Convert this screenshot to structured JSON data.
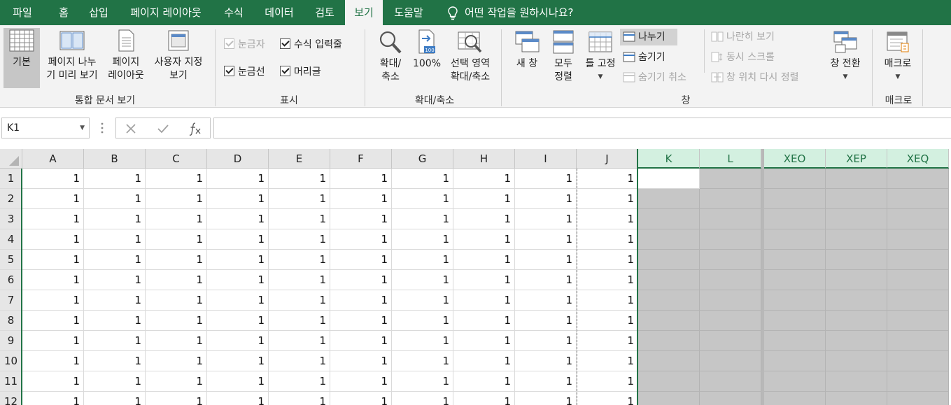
{
  "menu": {
    "tabs": [
      "파일",
      "홈",
      "삽입",
      "페이지 레이아웃",
      "수식",
      "데이터",
      "검토",
      "보기",
      "도움말"
    ],
    "active_tab": "보기",
    "tell_me": "어떤 작업을 원하시나요?"
  },
  "ribbon": {
    "workbook_views": {
      "normal": "기본",
      "page_break_line1": "페이지 나누",
      "page_break_line2": "기 미리 보기",
      "page_layout_line1": "페이지",
      "page_layout_line2": "레이아웃",
      "custom_line1": "사용자 지정",
      "custom_line2": "보기",
      "group_label": "통합 문서 보기"
    },
    "show": {
      "ruler": "눈금자",
      "formula_bar": "수식 입력줄",
      "gridlines": "눈금선",
      "headings": "머리글",
      "group_label": "표시"
    },
    "zoom": {
      "zoom_line1": "확대/",
      "zoom_line2": "축소",
      "hundred": "100%",
      "hundred_icon_text": "100",
      "selection_line1": "선택 영역",
      "selection_line2": "확대/축소",
      "group_label": "확대/축소"
    },
    "window": {
      "new_window": "새 창",
      "arrange_line1": "모두",
      "arrange_line2": "정렬",
      "freeze": "틀 고정",
      "split": "나누기",
      "hide": "숨기기",
      "unhide": "숨기기 취소",
      "side_by_side": "나란히 보기",
      "sync_scroll": "동시 스크롤",
      "reset_position": "창 위치 다시 정렬",
      "switch": "창 전환",
      "group_label": "창"
    },
    "macros": {
      "macros": "매크로",
      "group_label": "매크로"
    }
  },
  "formula_bar": {
    "name_box": "K1",
    "formula": ""
  },
  "grid": {
    "left_columns": [
      "A",
      "B",
      "C",
      "D",
      "E",
      "F",
      "G",
      "H",
      "I",
      "J",
      "K",
      "L"
    ],
    "right_columns": [
      "XEO",
      "XEP",
      "XEQ"
    ],
    "rows": [
      "1",
      "2",
      "3",
      "4",
      "5",
      "6",
      "7",
      "8",
      "9",
      "10",
      "11",
      "12"
    ],
    "cell_value": "1",
    "active_cell": "K1"
  }
}
